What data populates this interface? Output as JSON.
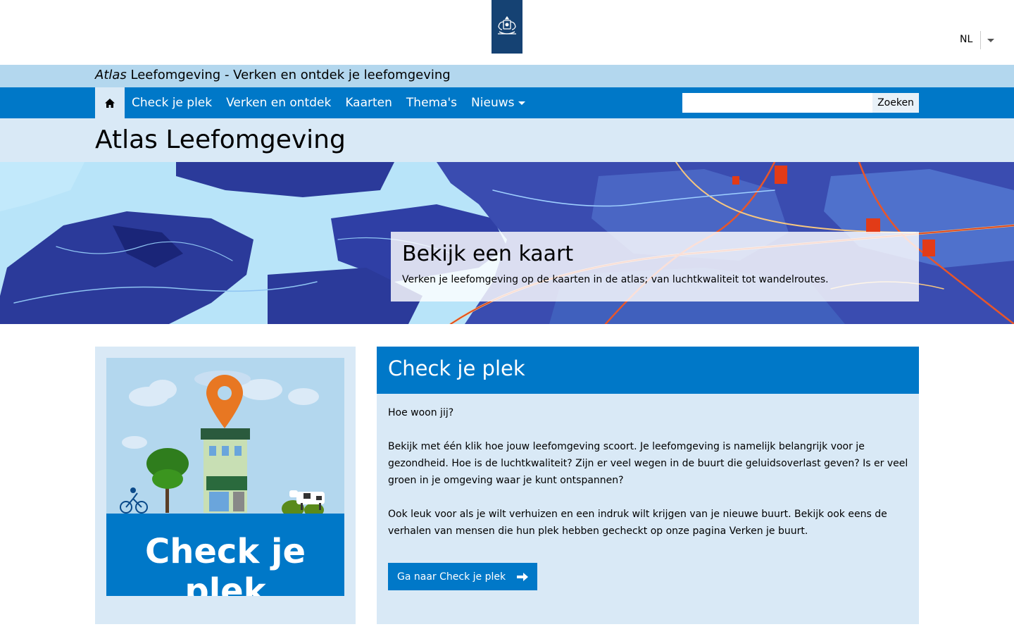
{
  "header": {
    "logo_icon": "rijksoverheid-coat-of-arms-icon",
    "language": "NL"
  },
  "site": {
    "name_italic": "Atlas",
    "name_rest": " Leefomgeving - Verken en ontdek je leefomgeving"
  },
  "nav": {
    "home_icon": "home-icon",
    "items": [
      "Check je plek",
      "Verken en ontdek",
      "Kaarten",
      "Thema's",
      "Nieuws"
    ],
    "search_placeholder": "",
    "search_button": "Zoeken"
  },
  "page": {
    "title": "Atlas Leefomgeving"
  },
  "hero": {
    "title": "Bekijk een kaart",
    "text": "Verken je leefomgeving op de kaarten in de atlas; van luchtkwaliteit tot wandelroutes."
  },
  "check_card": {
    "image_text": "Check je plek",
    "title": "Check je plek",
    "paragraphs": [
      "Hoe woon jij?",
      "Bekijk met één klik hoe jouw leefomgeving scoort. Je leefomgeving is namelijk belangrijk voor je gezondheid. Hoe is de luchtkwaliteit? Zijn er veel wegen in de buurt die geluidsoverlast geven? Is er veel groen in je omgeving waar je kunt ontspannen?",
      "Ook leuk voor als je wilt verhuizen en een indruk wilt krijgen van je nieuwe buurt. Bekijk ook eens de verhalen van mensen die hun plek hebben gecheckt op onze pagina Verken je buurt."
    ],
    "button_label": "Ga naar Check je plek",
    "button_icon": "arrow-right-icon"
  },
  "colors": {
    "brand_blue": "#0078c8",
    "logo_blue": "#154273",
    "light_blue": "#d9e9f6",
    "site_bar": "#b3d7ee"
  }
}
